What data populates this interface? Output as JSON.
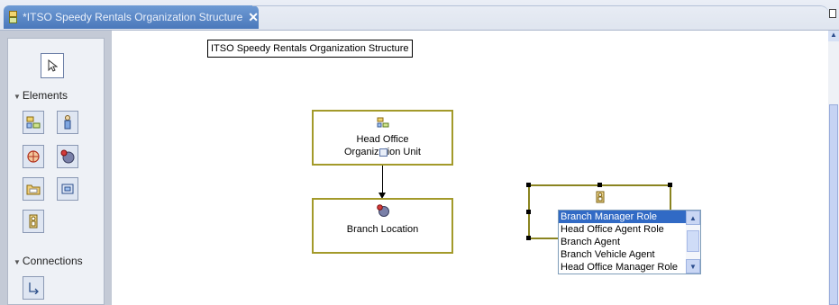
{
  "editor": {
    "tab_title": "*ITSO Speedy Rentals Organization Structure",
    "close_symbol": "✕"
  },
  "palette": {
    "select_tool_icon": "arrow-pointer-icon",
    "elements_label": "Elements",
    "element_tools": [
      "organization-unit-icon",
      "person-icon",
      "location-icon",
      "location-pin-icon",
      "folder-icon",
      "collection-icon",
      "role-icon"
    ],
    "connections_label": "Connections",
    "connection_tools": [
      "connection-icon"
    ]
  },
  "diagram": {
    "title": "ITSO Speedy Rentals Organization Structure",
    "nodes": {
      "head_office": {
        "line1": "Head Office",
        "line2": "Organization Unit",
        "icon": "organization-unit-icon"
      },
      "branch": {
        "label": "Branch Location",
        "icon": "location-pin-icon"
      },
      "role": {
        "icon": "role-icon"
      }
    }
  },
  "role_dropdown": {
    "selected": "Branch Manager Role",
    "options": [
      "Branch Manager Role",
      "Head Office Agent Role",
      "Branch Agent",
      "Branch Vehicle Agent",
      "Head Office Manager Role"
    ]
  },
  "colors": {
    "tab_active": "#4a78bb",
    "node_border": "#a39a2a",
    "selection": "#316ac5",
    "palette_bg": "#c4cad6"
  }
}
